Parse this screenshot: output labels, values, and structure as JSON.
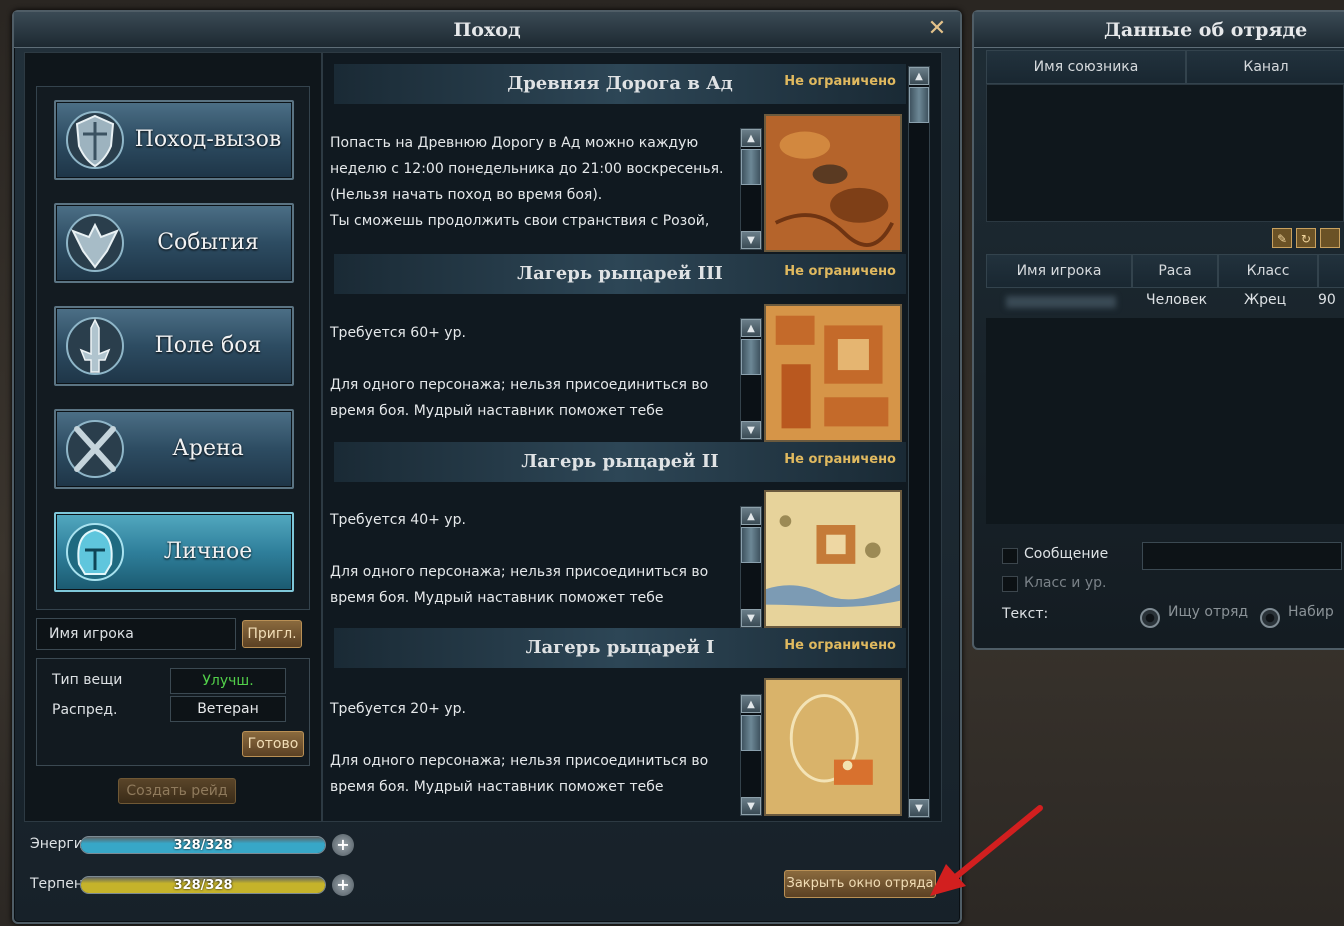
{
  "window": {
    "title": "Поход",
    "close_glyph": "✕"
  },
  "nav": {
    "items": [
      {
        "label": "Поход-вызов",
        "icon": "shield-icon"
      },
      {
        "label": "События",
        "icon": "mask-icon"
      },
      {
        "label": "Поле боя",
        "icon": "sword-hilt-icon"
      },
      {
        "label": "Арена",
        "icon": "crossed-swords-icon"
      },
      {
        "label": "Личное",
        "icon": "helmet-icon",
        "active": true
      }
    ]
  },
  "player": {
    "name_label": "Имя игрока",
    "invite_label": "Пригл."
  },
  "loot": {
    "type_label": "Тип вещи",
    "type_value": "Улучш.",
    "dist_label": "Распред.",
    "dist_value": "Ветеран",
    "ready_label": "Готово",
    "create_raid_label": "Создать рейд"
  },
  "instances": [
    {
      "title": "Древняя Дорога в Ад",
      "tag": "Не ограничено",
      "lines": [
        "Попасть на Древнюю Дорогу в Ад можно каждую",
        "неделю с 12:00 понедельника до 21:00 воскресенья.",
        " (Нельзя начать поход во время боя).",
        "Ты сможешь продолжить свои странствия с Розой,"
      ]
    },
    {
      "title": "Лагерь рыцарей III",
      "tag": "Не ограничено",
      "lines": [
        "Требуется 60+ ур.",
        "",
        "Для одного персонажа; нельзя присоединиться во",
        "время боя. Мудрый наставник поможет тебе"
      ]
    },
    {
      "title": "Лагерь рыцарей II",
      "tag": "Не ограничено",
      "lines": [
        "Требуется 40+ ур.",
        "",
        "Для одного персонажа; нельзя присоединиться во",
        "время боя. Мудрый наставник поможет тебе"
      ]
    },
    {
      "title": "Лагерь рыцарей I",
      "tag": "Не ограничено",
      "lines": [
        "Требуется 20+ ур.",
        "",
        "Для одного персонажа; нельзя присоединиться во",
        "время боя. Мудрый наставник поможет тебе"
      ]
    }
  ],
  "bars": {
    "energy": {
      "label": "Энергия",
      "value": "328/328",
      "fraction": 1.0,
      "color": "#37a7c7"
    },
    "patience": {
      "label": "Терпение",
      "value": "328/328",
      "fraction": 1.0,
      "color": "#c5b32a"
    }
  },
  "close_party_label": "Закрыть окно отряда",
  "party": {
    "title": "Данные об отряде",
    "ally_headers": [
      "Имя союзника",
      "Канал"
    ],
    "player_headers": [
      "Имя игрока",
      "Раса",
      "Класс"
    ],
    "rows": [
      {
        "race": "Человек",
        "class": "Жрец",
        "extra": "90"
      }
    ],
    "message_label": "Сообщение",
    "class_level_label": "Класс и ур.",
    "text_label": "Текст:",
    "radio_seek": "Ищу отряд",
    "radio_recruit": "Набир"
  },
  "colors": {
    "accent_gold": "#e0b95f",
    "green_text": "#52d04a",
    "arrow": "#d21f1f"
  }
}
